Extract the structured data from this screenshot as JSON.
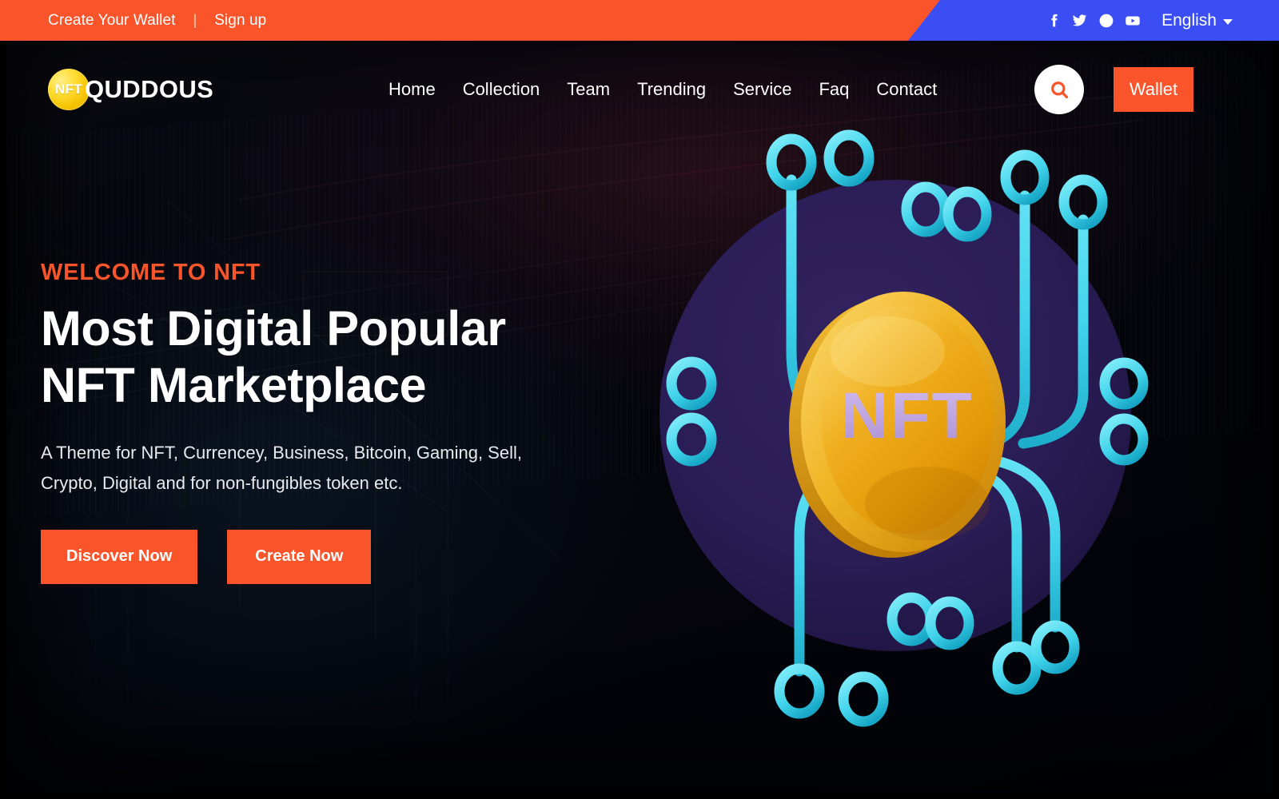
{
  "topbar": {
    "create_wallet": "Create Your Wallet",
    "separator": "|",
    "signup": "Sign up",
    "socials": [
      {
        "name": "facebook-icon",
        "label": "Facebook"
      },
      {
        "name": "twitter-icon",
        "label": "Twitter"
      },
      {
        "name": "dribbble-icon",
        "label": "Dribbble"
      },
      {
        "name": "youtube-icon",
        "label": "YouTube"
      }
    ],
    "language": "English",
    "colors": {
      "orange": "#f9542a",
      "blue": "#3a4ef4"
    }
  },
  "header": {
    "logo_badge": "NFT",
    "logo_text": "QUDDOUS",
    "nav": [
      {
        "label": "Home"
      },
      {
        "label": "Collection"
      },
      {
        "label": "Team"
      },
      {
        "label": "Trending"
      },
      {
        "label": "Service"
      },
      {
        "label": "Faq"
      },
      {
        "label": "Contact"
      }
    ],
    "search_label": "Search",
    "wallet_label": "Wallet"
  },
  "hero": {
    "eyebrow": "WELCOME TO NFT",
    "title_line1": "Most Digital Popular",
    "title_line2": "NFT Marketplace",
    "description": "A Theme for NFT, Currencey, Business, Bitcoin, Gaming, Sell, Crypto, Digital and for non-fungibles token etc.",
    "primary_button": "Discover Now",
    "secondary_button": "Create Now",
    "artwork": {
      "coin_label": "NFT",
      "colors": {
        "accent_orange": "#f9542a",
        "coin_gold": "#eca310",
        "coin_gold_light": "#f6c33c",
        "coin_text": "#c3a7e2",
        "node_cyan": "#3fd4ea",
        "circle_purple": "#271a55",
        "page_dark": "#05060a"
      }
    }
  }
}
